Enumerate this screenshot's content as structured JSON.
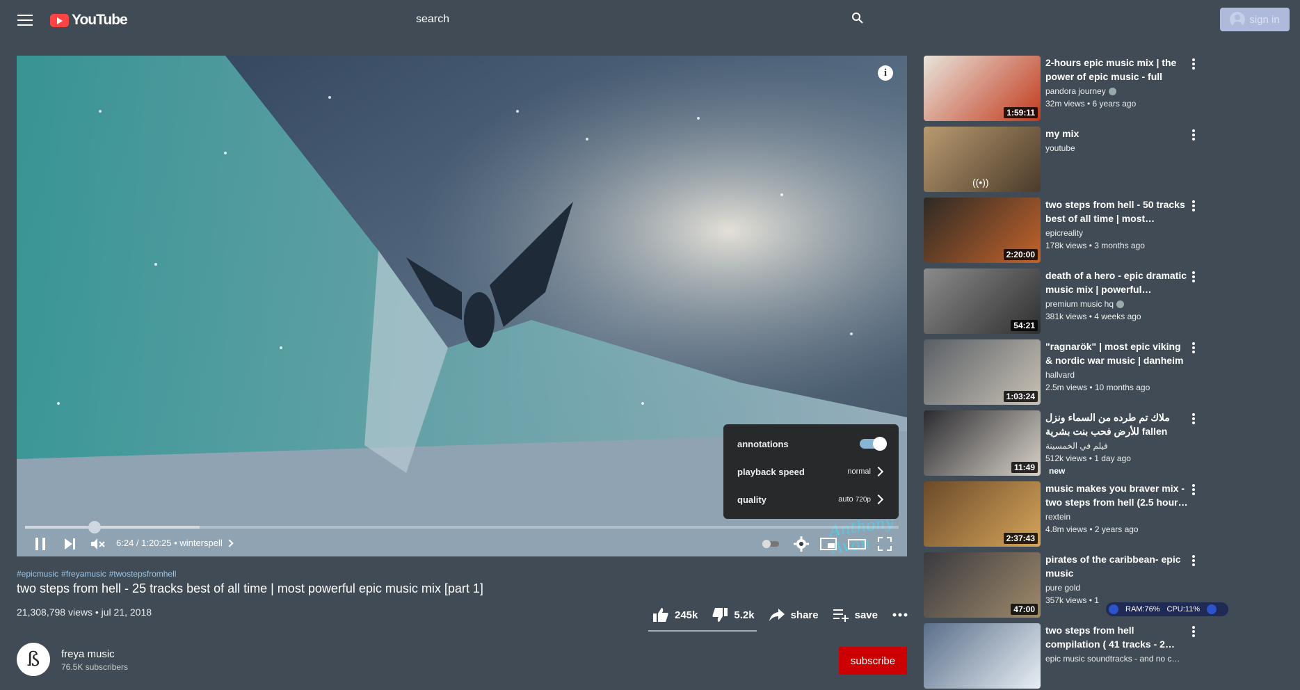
{
  "header": {
    "logo_text": "YouTube",
    "search_placeholder": "search",
    "signin_label": "sign in"
  },
  "player": {
    "time": "6:24 / 1:20:25",
    "chapter": "winterspell",
    "separator": "•",
    "progress_fraction": 0.0795,
    "watermark": "Anthony Avon",
    "settings": {
      "annotations_label": "annotations",
      "annotations_on": true,
      "speed_label": "playback speed",
      "speed_value": "normal",
      "quality_label": "quality",
      "quality_value": "auto",
      "quality_sub": "720p"
    }
  },
  "video": {
    "hashtags": [
      "#epicmusic",
      "#freyamusic",
      "#twostepsfromhell"
    ],
    "title": "two steps from hell - 25 tracks best of all time | most powerful epic music mix [part 1]",
    "views_date": "21,308,798 views • jul 21, 2018",
    "likes": "245k",
    "dislikes": "5.2k",
    "share_label": "share",
    "save_label": "save"
  },
  "channel": {
    "name": "freya music",
    "subscribers": "76.5K subscribers",
    "subscribe_label": "subscribe",
    "avatar_glyph": "ß"
  },
  "recommendations": [
    {
      "title": "2-hours epic music mix | the power of epic music - full mix…",
      "channel": "pandora journey",
      "verified": true,
      "stats": "32m views • 6 years ago",
      "duration": "1:59:11"
    },
    {
      "title": "my mix",
      "channel": "youtube",
      "verified": false,
      "stats": "",
      "duration": ""
    },
    {
      "title": "two steps from hell - 50 tracks best of all time | most…",
      "channel": "epicreality",
      "verified": false,
      "stats": "178k views • 3 months ago",
      "duration": "2:20:00"
    },
    {
      "title": "death of a hero - epic dramatic music mix | powerful…",
      "channel": "premium music hq",
      "verified": true,
      "stats": "381k views • 4 weeks ago",
      "duration": "54:21"
    },
    {
      "title": "\"ragnarök\" | most epic viking & nordic war music | danheim",
      "channel": "hallvard",
      "verified": false,
      "stats": "2.5m views • 10 months ago",
      "duration": "1:03:24"
    },
    {
      "title": "ملاك تم طرده من السماء ونزل للأرض فحب بنت بشرية fallen",
      "channel": "فيلم في الخمسينة",
      "verified": false,
      "stats": "512k views • 1 day ago",
      "duration": "11:49",
      "badge": "new"
    },
    {
      "title": "music makes you braver mix - two steps from hell (2.5 hour…",
      "channel": "rextein",
      "verified": false,
      "stats": "4.8m views • 2 years ago",
      "duration": "2:37:43"
    },
    {
      "title": "pirates of the caribbean- epic music",
      "channel": "pure gold",
      "verified": false,
      "stats": "357k views • 1",
      "duration": "47:00"
    },
    {
      "title": "two steps from hell compilation ( 41 tracks - 2…",
      "channel": "epic music soundtracks - and no c…",
      "verified": false,
      "stats": "",
      "duration": ""
    }
  ],
  "system_widget": {
    "ram": "RAM:76%",
    "cpu": "CPU:11%"
  },
  "colors": {
    "background": "#404b55",
    "subscribe": "#cc0000",
    "logo_red": "#ff4444"
  }
}
